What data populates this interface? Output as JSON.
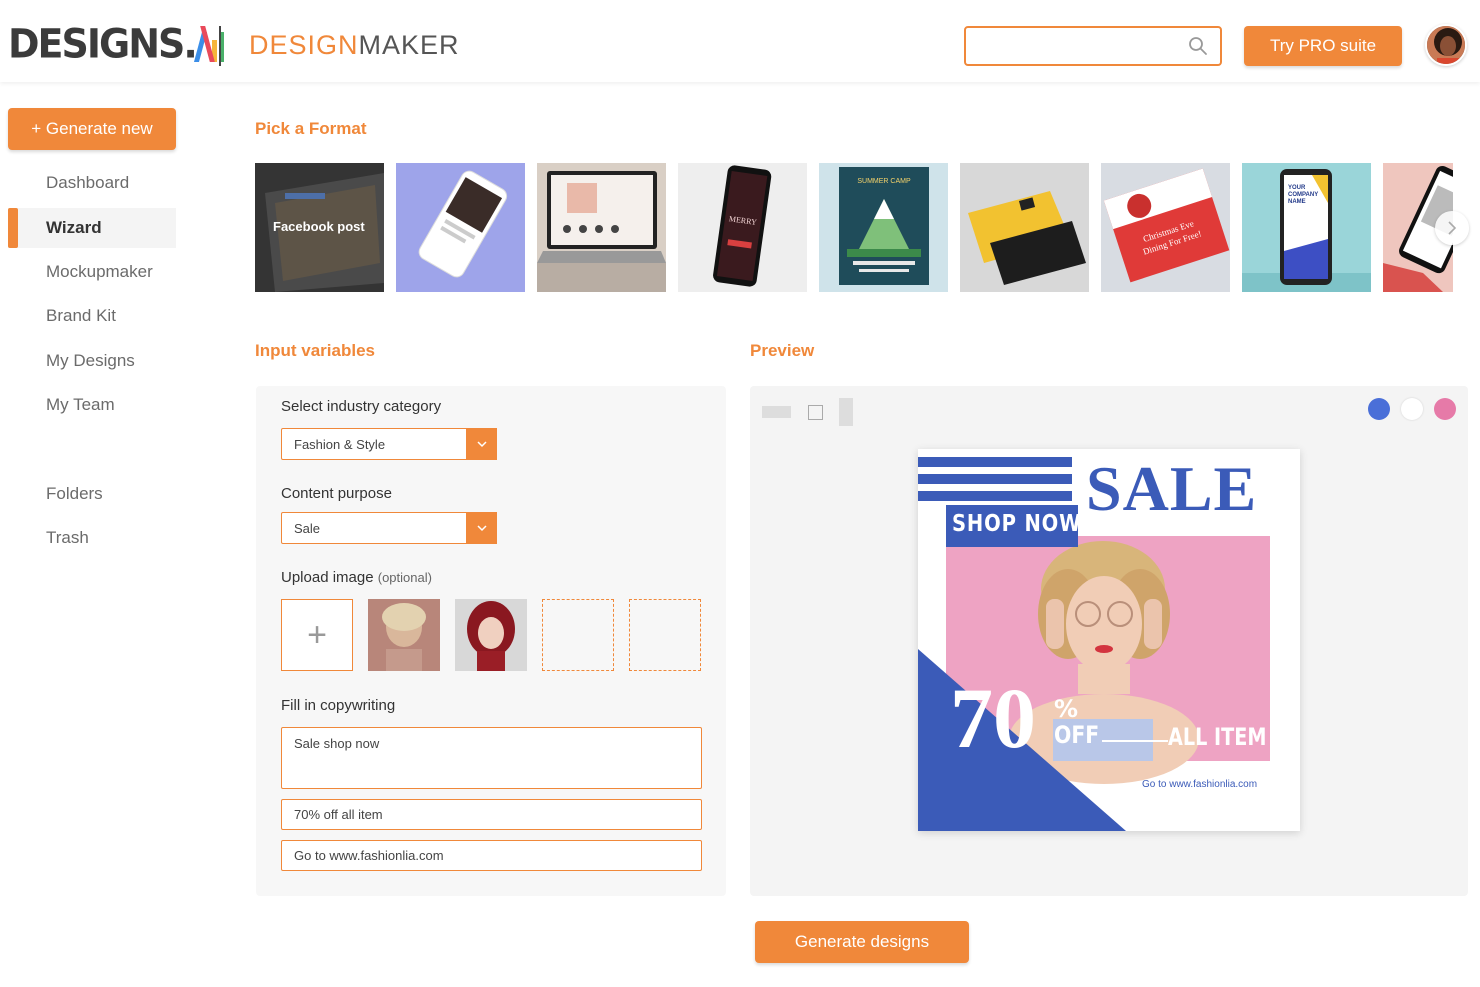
{
  "brand": {
    "logo_text": "DESIGNS.",
    "logo_ai": "AI",
    "product_accent": "DESIGN",
    "product_rest": "MAKER"
  },
  "header": {
    "search_placeholder": "",
    "pro_button": "Try PRO suite"
  },
  "sidebar": {
    "generate_new": "+ Generate new",
    "items": [
      {
        "label": "Dashboard",
        "active": false
      },
      {
        "label": "Wizard",
        "active": true
      },
      {
        "label": "Mockupmaker",
        "active": false
      },
      {
        "label": "Brand Kit",
        "active": false
      },
      {
        "label": "My Designs",
        "active": false
      },
      {
        "label": "My Team",
        "active": false
      }
    ],
    "secondary": [
      {
        "label": "Folders"
      },
      {
        "label": "Trash"
      }
    ]
  },
  "format_picker": {
    "title": "Pick a Format",
    "first_label": "Facebook post"
  },
  "input_variables": {
    "title": "Input variables",
    "industry_label": "Select industry category",
    "industry_value": "Fashion & Style",
    "purpose_label": "Content purpose",
    "purpose_value": "Sale",
    "upload_label": "Upload image",
    "upload_optional": "(optional)",
    "copy_label": "Fill in copywriting",
    "copy_1": "Sale shop now",
    "copy_2": "70% off all item",
    "copy_3": "Go to www.fashionlia.com"
  },
  "preview": {
    "title": "Preview",
    "color_options": [
      "#4a6fd8",
      "#ffffff",
      "#e67aa8"
    ],
    "card": {
      "sale": "SALE",
      "shop_now": "SHOP NOW",
      "big_num": "70",
      "percent": "%",
      "off": "OFF",
      "all_item": "ALL ITEM",
      "url": "Go to www.fashionlia.com"
    }
  },
  "actions": {
    "generate_designs": "Generate designs"
  },
  "colors": {
    "accent": "#f0883a",
    "card_blue": "#3b5bb8",
    "card_pink": "#eea3c3"
  }
}
